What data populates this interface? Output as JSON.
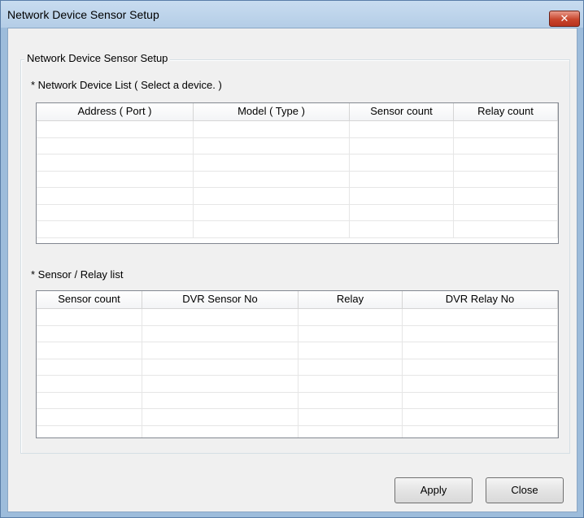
{
  "window": {
    "title": "Network Device Sensor Setup",
    "close_glyph": "✕"
  },
  "group": {
    "label": "Network Device Sensor Setup"
  },
  "device_list": {
    "label": "* Network Device List ( Select a device. )",
    "columns": [
      "Address ( Port )",
      "Model ( Type )",
      "Sensor count",
      "Relay count"
    ],
    "rows": [
      [
        "",
        "",
        "",
        ""
      ],
      [
        "",
        "",
        "",
        ""
      ],
      [
        "",
        "",
        "",
        ""
      ],
      [
        "",
        "",
        "",
        ""
      ],
      [
        "",
        "",
        "",
        ""
      ],
      [
        "",
        "",
        "",
        ""
      ],
      [
        "",
        "",
        "",
        ""
      ]
    ]
  },
  "sensor_list": {
    "label": "* Sensor / Relay list",
    "columns": [
      "Sensor count",
      "DVR Sensor No",
      "Relay",
      "DVR Relay No"
    ],
    "rows": [
      [
        "",
        "",
        "",
        ""
      ],
      [
        "",
        "",
        "",
        ""
      ],
      [
        "",
        "",
        "",
        ""
      ],
      [
        "",
        "",
        "",
        ""
      ],
      [
        "",
        "",
        "",
        ""
      ],
      [
        "",
        "",
        "",
        ""
      ],
      [
        "",
        "",
        "",
        ""
      ],
      [
        "",
        "",
        "",
        ""
      ]
    ]
  },
  "buttons": {
    "apply": "Apply",
    "close": "Close"
  }
}
